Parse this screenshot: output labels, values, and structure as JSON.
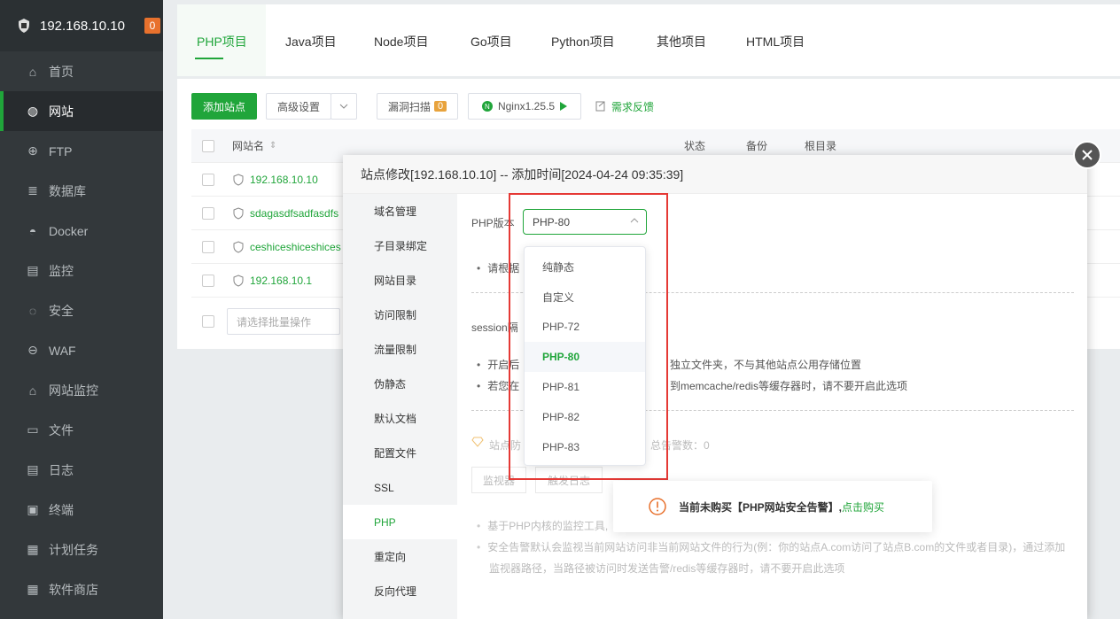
{
  "sidebar": {
    "host": "192.168.10.10",
    "badge": "0",
    "items": [
      {
        "label": "首页",
        "icon": "home-icon"
      },
      {
        "label": "网站",
        "icon": "globe-icon",
        "active": true
      },
      {
        "label": "FTP",
        "icon": "ftp-icon"
      },
      {
        "label": "数据库",
        "icon": "database-icon"
      },
      {
        "label": "Docker",
        "icon": "docker-icon"
      },
      {
        "label": "监控",
        "icon": "monitor-icon"
      },
      {
        "label": "安全",
        "icon": "shield-icon"
      },
      {
        "label": "WAF",
        "icon": "waf-icon"
      },
      {
        "label": "网站监控",
        "icon": "chart-icon"
      },
      {
        "label": "文件",
        "icon": "folder-icon"
      },
      {
        "label": "日志",
        "icon": "log-icon"
      },
      {
        "label": "终端",
        "icon": "terminal-icon"
      },
      {
        "label": "计划任务",
        "icon": "calendar-icon"
      },
      {
        "label": "软件商店",
        "icon": "apps-icon"
      }
    ]
  },
  "tabs": [
    "PHP项目",
    "Java项目",
    "Node项目",
    "Go项目",
    "Python项目",
    "其他项目",
    "HTML项目"
  ],
  "toolbar": {
    "add_site": "添加站点",
    "advanced": "高级设置",
    "vuln_scan": "漏洞扫描",
    "vuln_count": "0",
    "nginx": "Nginx1.25.5",
    "feedback": "需求反馈"
  },
  "table": {
    "headers": {
      "name": "网站名",
      "status": "状态",
      "backup": "备份",
      "root": "根目录"
    },
    "rows": [
      "192.168.10.10",
      "sdagasdfsadfasdfs",
      "ceshiceshiceshices",
      "192.168.10.1"
    ],
    "batch_placeholder": "请选择批量操作"
  },
  "modal": {
    "title": "站点修改[192.168.10.10] -- 添加时间[2024-04-24 09:35:39]",
    "nav": [
      "域名管理",
      "子目录绑定",
      "网站目录",
      "访问限制",
      "流量限制",
      "伪静态",
      "默认文档",
      "配置文件",
      "SSL",
      "PHP",
      "重定向",
      "反向代理"
    ],
    "active_nav": "PHP",
    "php_label": "PHP版本",
    "php_value": "PHP-80",
    "note1": "请根据",
    "session_label": "session隔",
    "bullet1_a": "开启后",
    "bullet1_b": "独立文件夹，不与其他站点公用存储位置",
    "bullet2_a": "若您在",
    "bullet2_b": "到memcache/redis等缓存器时，请不要开启此选项",
    "protect": "站点防",
    "alarm_total": "总告警数：0",
    "btn_monitor": "监视器",
    "btn_log": "触发日志",
    "tip1": "基于PHP内核的监控工具,",
    "tip2": "安全告警默认会监视当前网站访问非当前网站文件的行为(例：你的站点A.com访问了站点B.com的文件或者目录)，通过添加",
    "tip3": "监视器路径，当路径被访问时发送告警/redis等缓存器时，请不要开启此选项"
  },
  "dropdown": {
    "options": [
      "纯静态",
      "自定义",
      "PHP-72",
      "PHP-80",
      "PHP-81",
      "PHP-82",
      "PHP-83"
    ],
    "selected": "PHP-80"
  },
  "toast": {
    "message": "当前未购买【PHP网站安全告警】,",
    "link": "点击购买"
  },
  "colors": {
    "accent": "#20a53a",
    "sidebar": "#33383b",
    "highlight": "#e53935",
    "warning": "#e8712d"
  }
}
